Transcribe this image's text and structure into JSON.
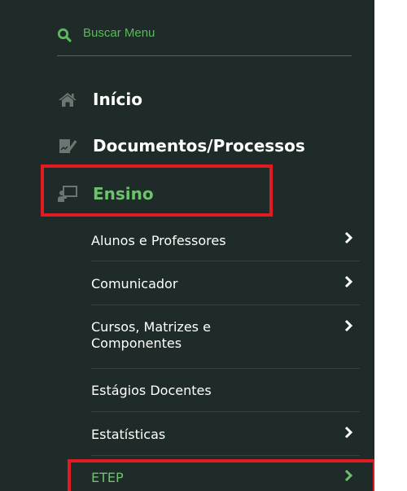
{
  "search": {
    "label": "Buscar Menu"
  },
  "menu": [
    {
      "label": "Início",
      "icon": "home-icon"
    },
    {
      "label": "Documentos/Processos",
      "icon": "document-pen-icon"
    },
    {
      "label": "Ensino",
      "icon": "teacher-board-icon",
      "active": true
    }
  ],
  "submenu": [
    {
      "label": "Alunos e Professores",
      "has_children": true
    },
    {
      "label": "Comunicador",
      "has_children": true
    },
    {
      "label": "Cursos, Matrizes e Componentes",
      "has_children": true
    },
    {
      "label": "Estágios Docentes",
      "has_children": false
    },
    {
      "label": "Estatísticas",
      "has_children": true
    },
    {
      "label": "ETEP",
      "has_children": true,
      "active": true
    }
  ],
  "colors": {
    "background": "#1e2b28",
    "accent": "#5cb85c",
    "highlight": "#e21b23"
  }
}
